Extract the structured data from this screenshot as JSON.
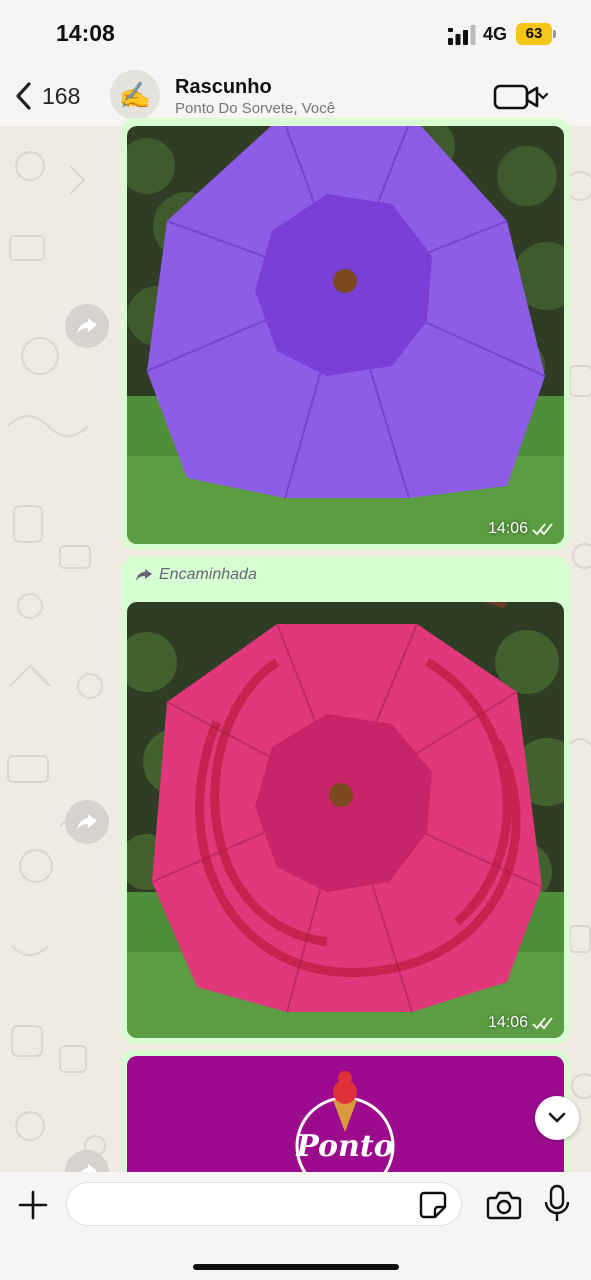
{
  "status_bar": {
    "time": "14:08",
    "network": "4G",
    "battery": "63",
    "signal_icon": "signal-bars-icon",
    "battery_color": "#f5c518"
  },
  "header": {
    "back_count": "168",
    "avatar_emoji": "✍️",
    "title": "Rascunho",
    "subtitle": "Ponto Do Sorvete, Você",
    "video_icon": "video-camera-icon"
  },
  "messages": [
    {
      "type": "image",
      "image": "purple-umbrella-photo",
      "time": "14:06",
      "status": "read-double-check"
    },
    {
      "type": "image",
      "forwarded_label": "Encaminhada",
      "image": "pink-umbrella-photo",
      "time": "14:06",
      "status": "read-double-check"
    },
    {
      "type": "image",
      "image": "ponto-do-sorvete-logo",
      "logo_text": "Ponto"
    }
  ],
  "input": {
    "placeholder": "",
    "value": ""
  },
  "colors": {
    "bubble": "#d9fdd3",
    "wallpaper": "#efeae2",
    "accent_purple": "#8e5de8",
    "accent_pink": "#e0387a",
    "logo_bg": "#9c0b8e"
  }
}
